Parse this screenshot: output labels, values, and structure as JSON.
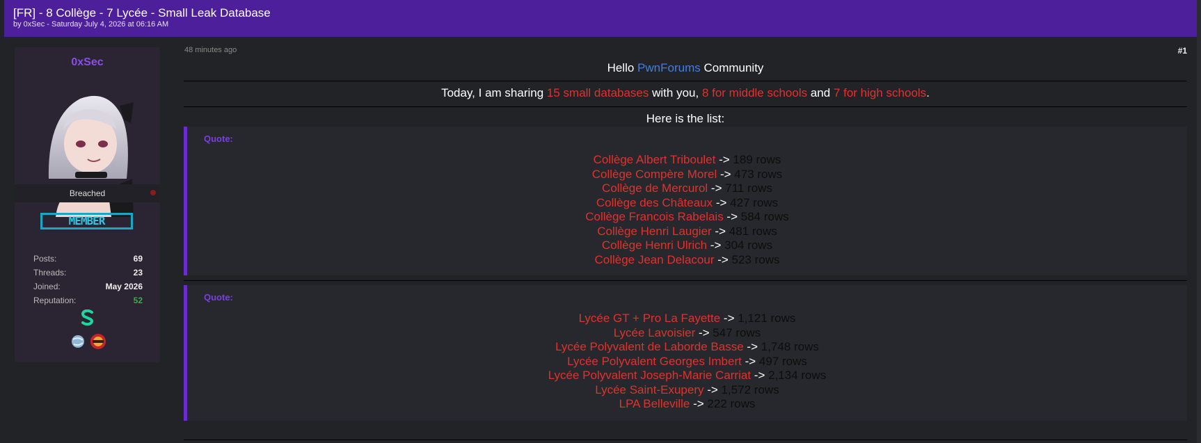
{
  "thread": {
    "title": "[FR] - 8 Collège - 7 Lycée - Small Leak Database",
    "meta": "by 0xSec - Saturday July 4, 2026 at 06:16 AM"
  },
  "user": {
    "name": "0xSec",
    "status": "Breached",
    "rank": "MEMBER",
    "stats": [
      {
        "label": "Posts:",
        "value": "69"
      },
      {
        "label": "Threads:",
        "value": "23"
      },
      {
        "label": "Joined:",
        "value": "May 2026"
      },
      {
        "label": "Reputation:",
        "value": "52"
      }
    ]
  },
  "post": {
    "time": "48 minutes ago",
    "number": "#1",
    "hello": {
      "before": "Hello ",
      "link": "PwnForums",
      "after": " Community"
    },
    "sharing": {
      "p1": "Today, I am sharing ",
      "r1": "15 small databases",
      "p2": " with you, ",
      "r2": "8 for middle schools",
      "p3": " and ",
      "r3": "7 for high schools",
      "p4": "."
    },
    "list_intro": "Here is the list:",
    "quotes": [
      {
        "label": "Quote:",
        "items": [
          {
            "name": "Collège Albert Triboulet",
            "arrow": " -> ",
            "rows": "189 rows"
          },
          {
            "name": "Collège Compère Morel",
            "arrow": " -> ",
            "rows": "473 rows"
          },
          {
            "name": "Collège de Mercurol",
            "arrow": " -> ",
            "rows": "711 rows"
          },
          {
            "name": "Collège des Châteaux",
            "arrow": " -> ",
            "rows": "427 rows"
          },
          {
            "name": "Collège Francois Rabelais",
            "arrow": " -> ",
            "rows": "584 rows"
          },
          {
            "name": "Collège Henri Laugier",
            "arrow": " -> ",
            "rows": "481 rows"
          },
          {
            "name": "Collège Henri Ulrich",
            "arrow": " -> ",
            "rows": "304 rows"
          },
          {
            "name": "Collège Jean Delacour",
            "arrow": " -> ",
            "rows": "523 rows"
          }
        ]
      },
      {
        "label": "Quote:",
        "items": [
          {
            "name": "Lycée GT + Pro La Fayette",
            "arrow": " -> ",
            "rows": "1,121 rows"
          },
          {
            "name": "Lycée Lavoisier",
            "arrow": " -> ",
            "rows": "547 rows"
          },
          {
            "name": "Lycée Polyvalent de Laborde Basse",
            "arrow": " -> ",
            "rows": "1,748 rows"
          },
          {
            "name": "Lycée Polyvalent Georges Imbert",
            "arrow": " -> ",
            "rows": "497 rows"
          },
          {
            "name": "Lycée Polyvalent Joseph-Marie Carriat",
            "arrow": " -> ",
            "rows": "2,134 rows"
          },
          {
            "name": "Lycée Saint-Exupery",
            "arrow": " -> ",
            "rows": "1,572 rows"
          },
          {
            "name": "LPA Belleville",
            "arrow": " -> ",
            "rows": "222 rows"
          }
        ]
      }
    ]
  },
  "colors": {
    "header_bg": "#4d1f9b",
    "accent_purple": "#7b3fe0",
    "link_blue": "#3f7fe3",
    "highlight_red": "#e0322d",
    "reputation_green": "#2fb24a",
    "rank_cyan": "#1aa6c4"
  },
  "icons": [
    "avatar-image",
    "status-offline-dot",
    "award-s-icon",
    "award-globe-icon",
    "award-badge-icon"
  ]
}
